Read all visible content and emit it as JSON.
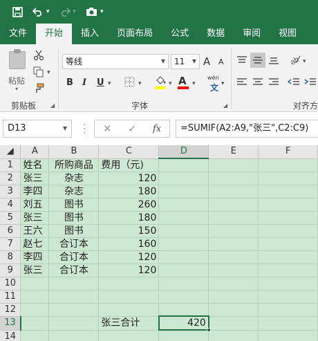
{
  "quick_access": {
    "save_icon": "save-icon",
    "undo_icon": "undo-icon",
    "redo_icon": "redo-icon",
    "camera_icon": "camera-icon",
    "customize_icon": "customize-icon"
  },
  "tabs": [
    {
      "label": "文件",
      "active": false
    },
    {
      "label": "开始",
      "active": true
    },
    {
      "label": "插入",
      "active": false
    },
    {
      "label": "页面布局",
      "active": false
    },
    {
      "label": "公式",
      "active": false
    },
    {
      "label": "数据",
      "active": false
    },
    {
      "label": "审阅",
      "active": false
    },
    {
      "label": "视图",
      "active": false
    }
  ],
  "ribbon": {
    "paste_label": "粘贴",
    "clipboard_label": "剪贴板",
    "font_label": "字体",
    "alignment_label": "对齐方",
    "font_name": "等线",
    "font_size": "11",
    "bold": "B",
    "italic": "I",
    "underline": "U",
    "grow_font": "A",
    "shrink_font": "A",
    "phonetic": "wén",
    "highlight_color": "#ffff00",
    "font_color": "#ff0000"
  },
  "formula_bar": {
    "name_box": "D13",
    "cancel": "✕",
    "enter": "✓",
    "fx": "fx",
    "formula": "=SUMIF(A2:A9,\"张三\",C2:C9)"
  },
  "sheet": {
    "columns": [
      "A",
      "B",
      "C",
      "D",
      "E",
      "F"
    ],
    "selected_column": "D",
    "selected_row": "13",
    "rows": [
      {
        "n": "1",
        "a": "姓名",
        "b": "所购商品",
        "c": "费用（元)",
        "d": ""
      },
      {
        "n": "2",
        "a": "张三",
        "b": "杂志",
        "c": "120",
        "d": ""
      },
      {
        "n": "3",
        "a": "李四",
        "b": "杂志",
        "c": "180",
        "d": ""
      },
      {
        "n": "4",
        "a": "刘五",
        "b": "图书",
        "c": "260",
        "d": ""
      },
      {
        "n": "5",
        "a": "张三",
        "b": "图书",
        "c": "180",
        "d": ""
      },
      {
        "n": "6",
        "a": "王六",
        "b": "图书",
        "c": "150",
        "d": ""
      },
      {
        "n": "7",
        "a": "赵七",
        "b": "合订本",
        "c": "160",
        "d": ""
      },
      {
        "n": "8",
        "a": "李四",
        "b": "合订本",
        "c": "120",
        "d": ""
      },
      {
        "n": "9",
        "a": "张三",
        "b": "合订本",
        "c": "120",
        "d": ""
      },
      {
        "n": "10",
        "a": "",
        "b": "",
        "c": "",
        "d": ""
      },
      {
        "n": "11",
        "a": "",
        "b": "",
        "c": "",
        "d": ""
      },
      {
        "n": "12",
        "a": "",
        "b": "",
        "c": "",
        "d": ""
      },
      {
        "n": "13",
        "a": "",
        "b": "",
        "c": "张三合计",
        "d": "420"
      },
      {
        "n": "14",
        "a": "",
        "b": "",
        "c": "",
        "d": ""
      }
    ]
  },
  "colors": {
    "brand": "#217346",
    "grid_background": "#cde8d2"
  }
}
